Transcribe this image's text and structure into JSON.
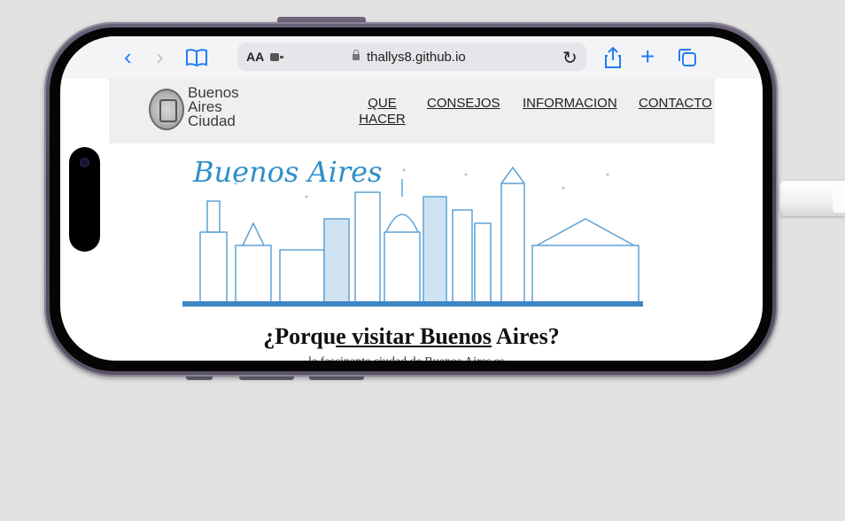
{
  "browser": {
    "url": "thallys8.github.io",
    "text_size_label": "AA"
  },
  "site": {
    "logo": {
      "line1": "Buenos",
      "line2": "Aires",
      "line3": "Ciudad"
    },
    "nav": [
      {
        "label": "QUE HACER"
      },
      {
        "label": "CONSEJOS"
      },
      {
        "label": "INFORMACION"
      },
      {
        "label": "CONTACTO"
      }
    ],
    "hero_title": "Buenos Aires",
    "heading": {
      "part1": "¿Porqu",
      "underlined": "e visitar Buenos",
      "part2": " Aires?"
    },
    "subtext_fragment": "la fascinante ciudad de Buenos Aires es una"
  },
  "colors": {
    "accent": "#1f7ef6",
    "skyline": "#5ea2d6"
  }
}
